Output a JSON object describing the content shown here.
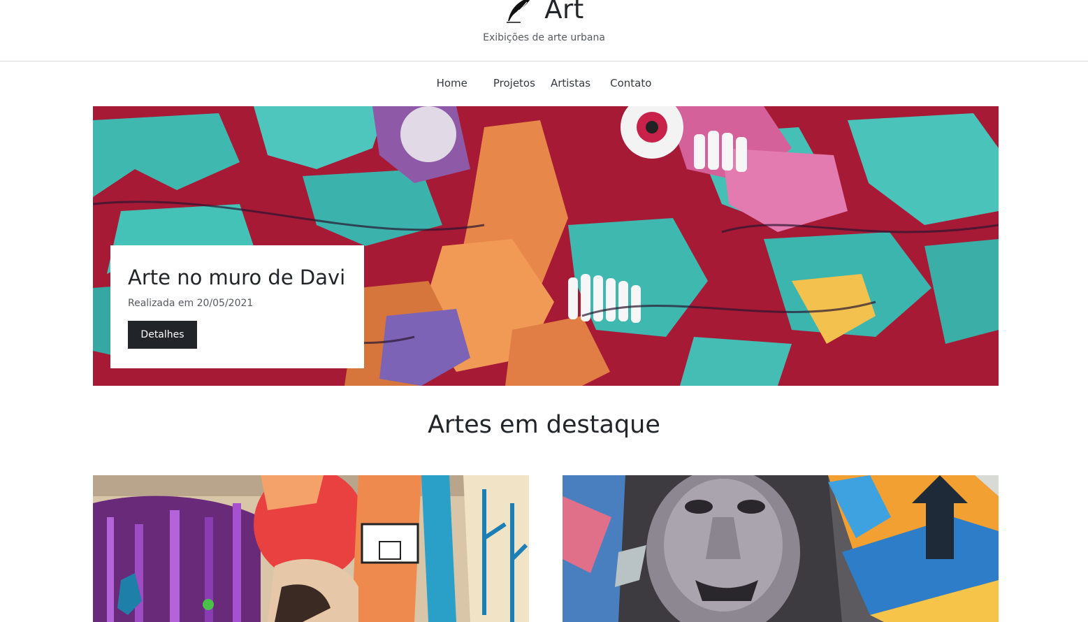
{
  "header": {
    "title": "Art",
    "tagline": "Exibições de arte urbana",
    "logo_icon": "feather-quill-icon"
  },
  "nav": {
    "items": [
      {
        "label": "Home"
      },
      {
        "label": "Projetos"
      },
      {
        "label": "Artistas"
      },
      {
        "label": "Contato"
      }
    ]
  },
  "hero": {
    "title": "Arte no muro de Davi",
    "date": "Realizada em 20/05/2021",
    "button_label": "Detalhes",
    "image": "graffiti mural with face, teeth and machinery"
  },
  "featured": {
    "title": "Artes em destaque",
    "cards": [
      {
        "image": "mural with purple trees, deer and basketball hoop"
      },
      {
        "image": "mural portrait of a man with colorful arrows"
      }
    ]
  },
  "colors": {
    "text_dark": "#212529",
    "text_muted": "#555a60",
    "button_bg": "#212529",
    "border": "#d9d9d9",
    "mural_teal": "#3fb8b0",
    "mural_red": "#b21e3c",
    "mural_orange": "#e8874a"
  }
}
